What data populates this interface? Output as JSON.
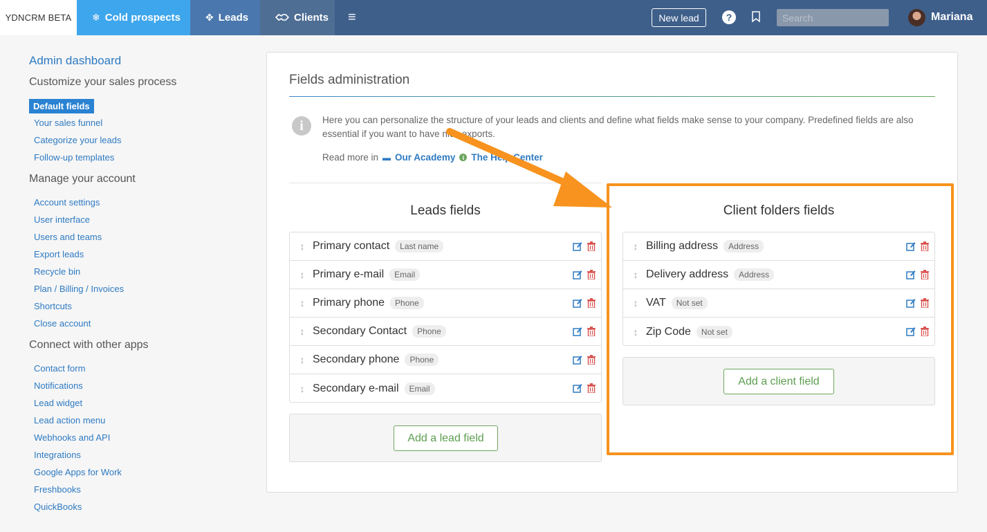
{
  "topbar": {
    "brand": "YDNCRM BETA",
    "tabs": [
      {
        "label": "Cold prospects",
        "icon": "snowflake-icon"
      },
      {
        "label": "Leads",
        "icon": "crosshair-icon"
      },
      {
        "label": "Clients",
        "icon": "handshake-icon"
      }
    ],
    "new_lead_label": "New lead",
    "search_placeholder": "Search",
    "user_name": "Mariana"
  },
  "sidebar": {
    "title": "Admin dashboard",
    "sections": [
      {
        "heading": "Customize your sales process",
        "items": [
          "Default fields",
          "Your sales funnel",
          "Categorize your leads",
          "Follow-up templates"
        ]
      },
      {
        "heading": "Manage your account",
        "items": [
          "Account settings",
          "User interface",
          "Users and teams",
          "Export leads",
          "Recycle bin",
          "Plan / Billing / Invoices",
          "Shortcuts",
          "Close account"
        ]
      },
      {
        "heading": "Connect with other apps",
        "items": [
          "Contact form",
          "Notifications",
          "Lead widget",
          "Lead action menu",
          "Webhooks and API",
          "Integrations",
          "Google Apps for Work",
          "Freshbooks",
          "QuickBooks"
        ]
      }
    ],
    "active_item": "Default fields"
  },
  "main": {
    "title": "Fields administration",
    "info_text": "Here you can personalize the structure of your leads and clients and define what fields make sense to your company. Predefined fields are also essential if you want to have nice exports.",
    "read_more_prefix": "Read more in",
    "academy_link": "Our Academy",
    "help_center_link": "The Help Center",
    "leads": {
      "title": "Leads fields",
      "fields": [
        {
          "name": "Primary contact",
          "type": "Last name"
        },
        {
          "name": "Primary e-mail",
          "type": "Email"
        },
        {
          "name": "Primary phone",
          "type": "Phone"
        },
        {
          "name": "Secondary Contact",
          "type": "Phone"
        },
        {
          "name": "Secondary phone",
          "type": "Phone"
        },
        {
          "name": "Secondary e-mail",
          "type": "Email"
        }
      ],
      "add_label": "Add a lead field"
    },
    "clients": {
      "title": "Client folders fields",
      "fields": [
        {
          "name": "Billing address",
          "type": "Address"
        },
        {
          "name": "Delivery address",
          "type": "Address"
        },
        {
          "name": "VAT",
          "type": "Not set"
        },
        {
          "name": "Zip Code",
          "type": "Not set"
        }
      ],
      "add_label": "Add a client field"
    }
  },
  "colors": {
    "nav_bg": "#3e5f8a",
    "cold_tab": "#3ea6ec",
    "link": "#2e7ac2",
    "add_button": "#6ba55e",
    "highlight": "#f7931e"
  }
}
